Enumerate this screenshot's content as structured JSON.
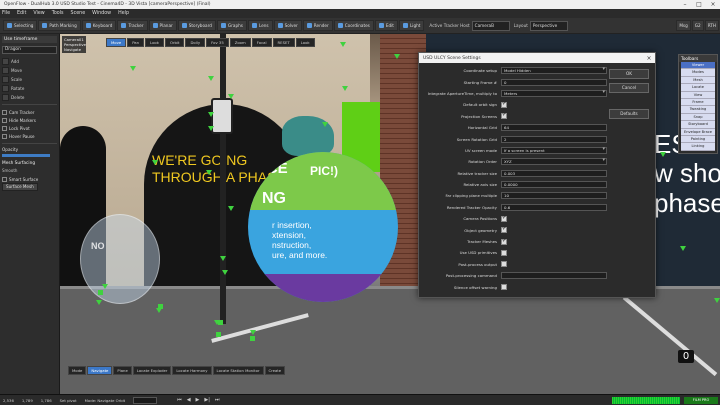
{
  "window": {
    "title": "OpenFlow - DualHub 3.0 USD Studio Test - Cinema4D - 3D Vista [cameraPerspective] (Final)"
  },
  "menubar": [
    "File",
    "Edit",
    "View",
    "Tools",
    "Scene",
    "Window",
    "Help"
  ],
  "toolbar": {
    "buttons": [
      "Selecting",
      "Path Marking",
      "Keyboard",
      "Tracker",
      "Planar",
      "Storyboard",
      "Graphs",
      "Lens",
      "Solver",
      "Render",
      "Coordinates",
      "Edit",
      "Light"
    ],
    "active_tracker_label": "Active Tracker Host",
    "active_tracker_value": "CameraB",
    "layout_label": "Layout",
    "layout_value": "Perspective",
    "right_buttons": [
      "Msg",
      "G2",
      "RTH"
    ]
  },
  "leftpanel": {
    "header": "Use timeframe",
    "dropdown": "Dragon",
    "rows": [
      "Add",
      "Move",
      "Scale",
      "Rotate",
      "Delete"
    ],
    "checks": [
      "Cam Tracker",
      "Hide Markers",
      "Lock Pivot",
      "Hover Pause"
    ],
    "opacity_label": "Opacity",
    "mesh_section": "Mesh Surfacing",
    "mesh_sub": "Smooth",
    "mesh_check": "Smart Surface",
    "mesh_button": "Surface Mesh"
  },
  "viewport": {
    "corner": "Camera01 Perspective Navigate",
    "tabs": [
      "Move",
      "Pan",
      "Look",
      "Orbit",
      "Dolly",
      "Fov 35",
      "Zoom",
      "Focal",
      "RESET",
      "Look"
    ],
    "wall_text": [
      "WE'RE GOING",
      "THROUGH A PHASE"
    ],
    "sphere_top": "NCE",
    "sphere_mid": "PIC!)",
    "sphere_word": "NG",
    "sphere_lines": [
      "r insertion,",
      "xtension,",
      "nstruction,",
      "ure, and more."
    ],
    "small_sphere": "NO",
    "store_lines": [
      "ES",
      "w shop",
      "phase."
    ],
    "bottom_tabs": [
      "Mode",
      "Navigate",
      "Plane",
      "Locate Exploder",
      "Locate Harmony",
      "Locate Station Monitor",
      "Create"
    ],
    "count": "0"
  },
  "dialog": {
    "title": "USD ULCY Scene Settings",
    "close": "×",
    "rows": [
      {
        "label": "Coordinate setup",
        "type": "dropdown",
        "value": "Model Hidden"
      },
      {
        "label": "Starting Frame #",
        "type": "field",
        "value": "0"
      },
      {
        "label": "Integrate ApertureTime, multiply to",
        "type": "dropdown",
        "value": "Meters"
      },
      {
        "label": "Default orbit sign",
        "type": "check",
        "value": true
      },
      {
        "label": "Projection Screens",
        "type": "check",
        "value": true
      },
      {
        "label": "Horizontal Grid",
        "type": "field",
        "value": "64"
      },
      {
        "label": "Screen Rotation Grid",
        "type": "field",
        "value": "2"
      },
      {
        "label": "UV screen mode",
        "type": "dropdown",
        "value": "If a screen is present"
      },
      {
        "label": "Rotation Order",
        "type": "dropdown",
        "value": "XYZ"
      },
      {
        "label": "Relative tracker size",
        "type": "field",
        "value": "0.003"
      },
      {
        "label": "Relative axis size",
        "type": "field",
        "value": "0.0000"
      },
      {
        "label": "Far clipping plane multiple",
        "type": "field",
        "value": "10"
      },
      {
        "label": "Rendered Tracker Opacity",
        "type": "field",
        "value": "0.6"
      },
      {
        "label": "Camera Positions",
        "type": "check",
        "value": true
      },
      {
        "label": "Object geometry",
        "type": "check",
        "value": true
      },
      {
        "label": "Tracker Meshes",
        "type": "check",
        "value": true
      },
      {
        "label": "Use USD primitives",
        "type": "check",
        "value": false
      },
      {
        "label": "Post-process output",
        "type": "check",
        "value": false
      },
      {
        "label": "Post-processing command",
        "type": "field",
        "value": ""
      },
      {
        "label": "Silence offset warning",
        "type": "check",
        "value": false
      }
    ],
    "buttons": {
      "ok": "OK",
      "cancel": "Cancel",
      "defaults": "Defaults"
    }
  },
  "toolbars_panel": {
    "title": "Toolbars",
    "items": [
      "Viewer",
      "Modes",
      "Mesh",
      "Locate",
      "View",
      "Frame",
      "Tweaking",
      "Snap",
      "Storyboard",
      "Envelope Brace",
      "Painting",
      "Linking",
      "Tracking"
    ],
    "selected_index": 0
  },
  "timeline": {
    "start_label": "2,536",
    "start_value": "1,789",
    "end_value": "1,786",
    "status": "Set pivot",
    "mode": "Mode: Navigate Orbit",
    "frame_field": "0",
    "badge": "FILM PRO"
  },
  "colors": {
    "accent": "#3c78c8",
    "tracker_green": "#3fd23f",
    "green_wall": "#5fcf16"
  }
}
